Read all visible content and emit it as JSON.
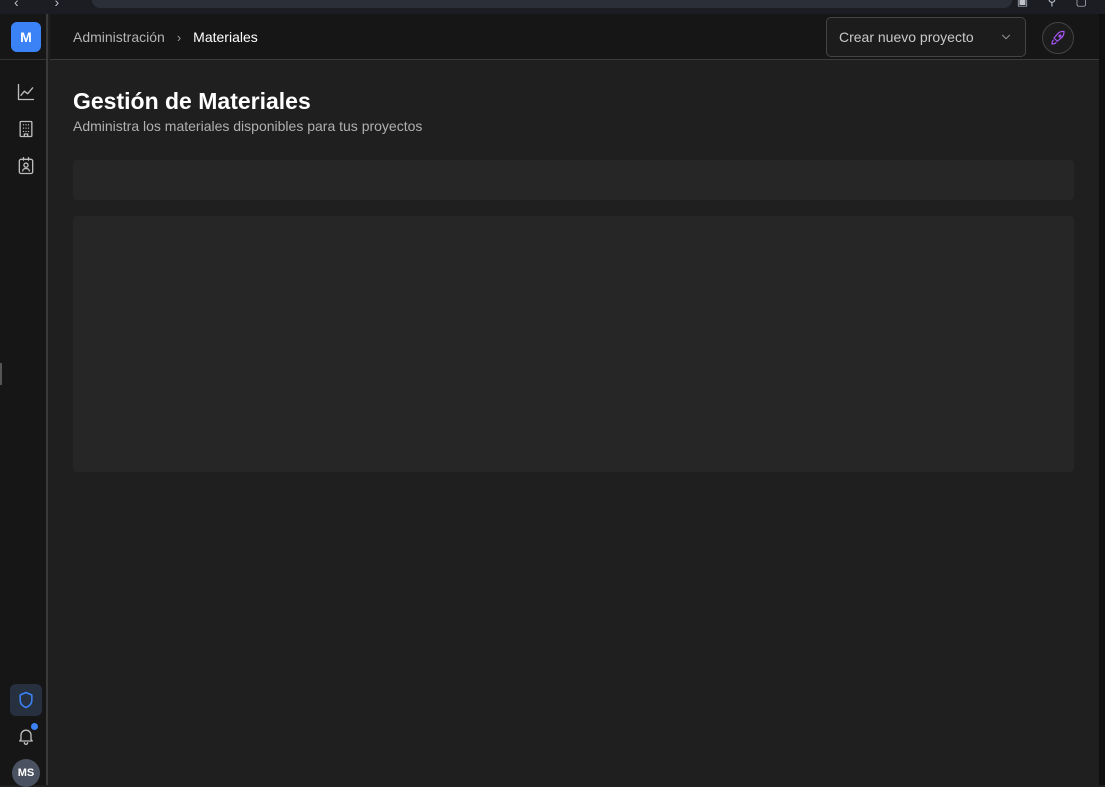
{
  "browser": {
    "nav_glyphs": "‹ › ⟳",
    "url": "/",
    "right_icons": "▣ ⚲ ▢"
  },
  "sidebar": {
    "logo_letter": "M",
    "items": [
      {
        "name": "analytics",
        "icon": "chart-line-icon"
      },
      {
        "name": "buildings",
        "icon": "building-icon"
      },
      {
        "name": "contacts",
        "icon": "contact-card-icon"
      }
    ],
    "bottom": [
      {
        "name": "admin",
        "icon": "shield-icon",
        "active": true
      },
      {
        "name": "notifications",
        "icon": "bell-icon",
        "has_badge": true
      }
    ],
    "avatar_initials": "MS"
  },
  "header": {
    "breadcrumb": [
      "Administración",
      "Materiales"
    ],
    "project_select": {
      "value": "Crear nuevo proyecto",
      "icon": "chevron-down-icon"
    },
    "action_icon": "rocket-icon"
  },
  "main": {
    "title": "Gestión de Materiales",
    "subtitle": "Administra los materiales disponibles para tus proyectos"
  },
  "colors": {
    "accent": "#3b82f6",
    "rocket": "#a855f7",
    "background": "#1f1f1f",
    "panel": "#262626"
  }
}
